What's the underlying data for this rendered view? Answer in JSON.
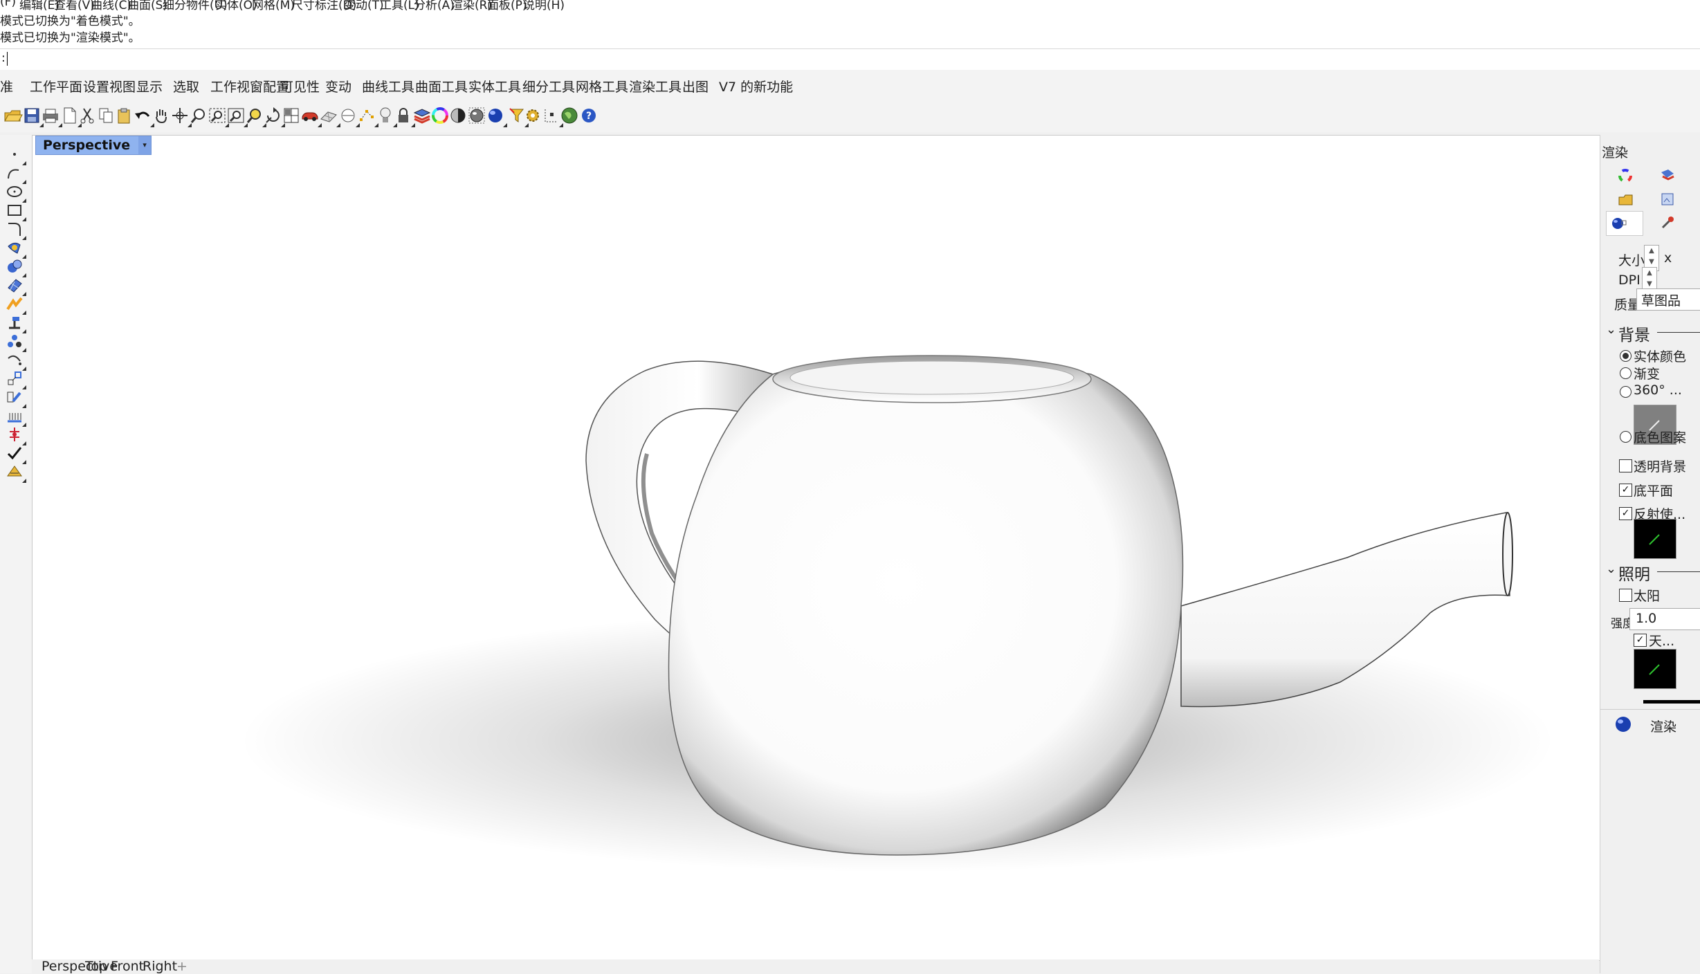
{
  "menu": {
    "items": [
      "(F)",
      "编辑(E)",
      "查看(V)",
      "曲线(C)",
      "曲面(S)",
      "细分物件(U)",
      "实体(O)",
      "网格(M)",
      "尺寸标注(D)",
      "变动(T)",
      "工具(L)",
      "分析(A)",
      "渲染(R)",
      "面板(P)",
      "说明(H)"
    ]
  },
  "command_history": {
    "line1": "模式已切换为\"着色模式\"。",
    "line2": "模式已切换为\"渲染模式\"。"
  },
  "command_line": {
    "prompt": ":"
  },
  "tabs": [
    "准",
    "工作平面",
    "设置视图",
    "显示",
    "选取",
    "工作视窗配置",
    "可见性",
    "变动",
    "曲线工具",
    "曲面工具",
    "实体工具",
    "细分工具",
    "网格工具",
    "渲染工具",
    "出图",
    "V7 的新功能"
  ],
  "toolbar_icons": [
    "open-icon",
    "save-icon",
    "print-icon",
    "new-icon",
    "cut-icon",
    "copy-icon",
    "paste-icon",
    "undo-icon",
    "pan-icon",
    "rotate-view-icon",
    "zoom-icon",
    "zoom-window-icon",
    "zoom-extents-icon",
    "zoom-selected-icon",
    "rotate-icon",
    "four-view-icon",
    "car-icon",
    "grid-icon",
    "cplane-icon",
    "point-icon",
    "light-icon",
    "lock-icon",
    "layer-icon",
    "color-wheel-icon",
    "shaded-icon",
    "render-icon",
    "sphere-icon",
    "filter-icon",
    "options-icon",
    "snap-icon",
    "earth-icon",
    "help-icon"
  ],
  "left_toolbar_icons": [
    "point-icon",
    "polyline-icon",
    "circle-icon",
    "rectangle-icon",
    "fillet-icon",
    "surface-icon",
    "solid-icon",
    "mesh-icon",
    "transform-icon",
    "dimension-icon",
    "group-icon",
    "curve-icon",
    "scale-icon",
    "edit-icon",
    "array-icon",
    "gumball-icon",
    "check-icon",
    "analyze-icon"
  ],
  "viewport": {
    "title": "Perspective",
    "dropdown_glyph": "▾"
  },
  "viewport_tabs": [
    "Perspective",
    "Top",
    "Front",
    "Right",
    "+"
  ],
  "right_panel": {
    "title": "渲染",
    "size_label": "大小:",
    "size_x": "x",
    "dpi_label": "DPI:",
    "quality_label": "质量:",
    "quality_value": "草图品",
    "background_header": "背景",
    "bg_options": [
      {
        "label": "实体颜色",
        "selected": true
      },
      {
        "label": "渐变",
        "selected": false
      },
      {
        "label": "360° ...",
        "selected": false
      },
      {
        "label": "底色图案",
        "selected": false
      }
    ],
    "transparent_bg": {
      "label": "透明背景",
      "checked": false
    },
    "ground_plane": {
      "label": "底平面",
      "checked": true,
      "mark": "✓"
    },
    "reflective": {
      "label": "反射使...",
      "checked": true,
      "mark": "✓"
    },
    "lighting_header": "照明",
    "sun": {
      "label": "太阳",
      "checked": false
    },
    "intensity_label": "强度:",
    "intensity_value": "1.0",
    "sky": {
      "label": "天...",
      "checked": true,
      "mark": "✓"
    },
    "render_label": "渲染"
  },
  "colors": {
    "viewport_title_bg": "#8fb3ef",
    "panel_bg": "#f0f0f0",
    "swatch_gray": "#808080",
    "swatch_black": "#000000"
  }
}
